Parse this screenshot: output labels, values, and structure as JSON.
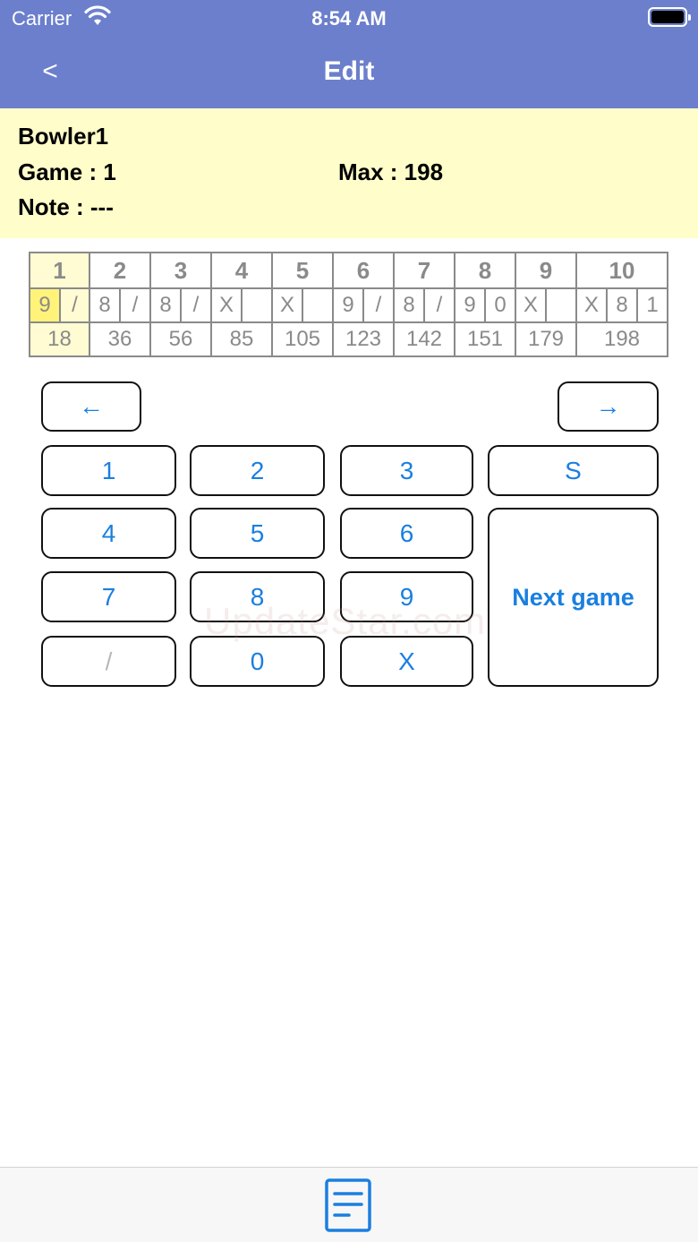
{
  "status_bar": {
    "carrier": "Carrier",
    "time": "8:54 AM"
  },
  "nav": {
    "back_label": "<",
    "title": "Edit"
  },
  "info": {
    "bowler": "Bowler1",
    "game": "Game : 1",
    "max": "Max : 198",
    "note": "Note : ---"
  },
  "scorecard": {
    "frames": [
      "1",
      "2",
      "3",
      "4",
      "5",
      "6",
      "7",
      "8",
      "9",
      "10"
    ],
    "balls": [
      [
        "9",
        "/"
      ],
      [
        "8",
        "/"
      ],
      [
        "8",
        "/"
      ],
      [
        "X",
        ""
      ],
      [
        "X",
        ""
      ],
      [
        "9",
        "/"
      ],
      [
        "8",
        "/"
      ],
      [
        "9",
        "0"
      ],
      [
        "X",
        ""
      ],
      [
        "X",
        "8",
        "1"
      ]
    ],
    "totals": [
      "18",
      "36",
      "56",
      "85",
      "105",
      "123",
      "142",
      "151",
      "179",
      "198"
    ],
    "selected_frame": "1"
  },
  "keypad": {
    "prev": "←",
    "next": "→",
    "k1": "1",
    "k2": "2",
    "k3": "3",
    "ks": "S",
    "k4": "4",
    "k5": "5",
    "k6": "6",
    "k7": "7",
    "k8": "8",
    "k9": "9",
    "kslash": "/",
    "k0": "0",
    "kx": "X",
    "next_game": "Next game"
  },
  "watermark": "UpdateStar.com",
  "colors": {
    "nav_bar": "#6b7fcc",
    "info_bg": "#fffdc9",
    "accent": "#1a7fe0",
    "selected_ball": "#fff37a"
  },
  "tabbar": {
    "icon": "document-icon"
  }
}
